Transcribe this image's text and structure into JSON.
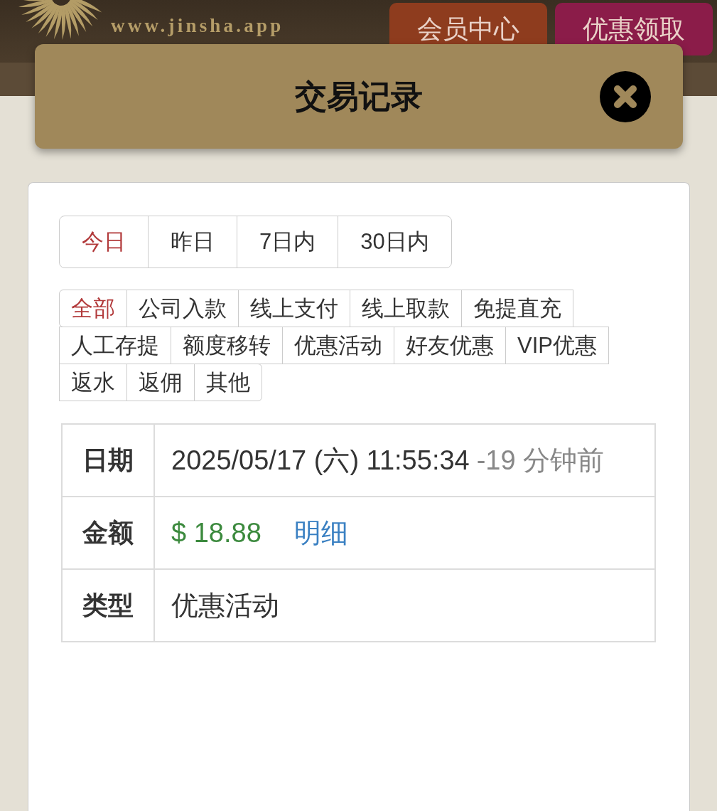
{
  "header": {
    "site": "www.jinsha.app",
    "buttons": [
      {
        "label": "会员中心",
        "color": "#8e3c1e"
      },
      {
        "label": "优惠领取",
        "color": "#8b1c49"
      }
    ]
  },
  "dialog": {
    "title": "交易记录"
  },
  "date_range": [
    {
      "label": "今日",
      "selected": true
    },
    {
      "label": "昨日",
      "selected": false
    },
    {
      "label": "7日内",
      "selected": false
    },
    {
      "label": "30日内",
      "selected": false
    }
  ],
  "categories": [
    {
      "label": "全部",
      "selected": true
    },
    {
      "label": "公司入款",
      "selected": false
    },
    {
      "label": "线上支付",
      "selected": false
    },
    {
      "label": "线上取款",
      "selected": false
    },
    {
      "label": "免提直充",
      "selected": false
    },
    {
      "label": "人工存提",
      "selected": false
    },
    {
      "label": "额度移转",
      "selected": false
    },
    {
      "label": "优惠活动",
      "selected": false
    },
    {
      "label": "好友优惠",
      "selected": false
    },
    {
      "label": "VIP优惠",
      "selected": false
    },
    {
      "label": "返水",
      "selected": false
    },
    {
      "label": "返佣",
      "selected": false
    },
    {
      "label": "其他",
      "selected": false
    }
  ],
  "record": {
    "rows": [
      {
        "kind": "date",
        "label": "日期",
        "value": "2025/05/17 (六) 11:55:34",
        "relative": "-19 分钟前"
      },
      {
        "kind": "amount",
        "label": "金额",
        "value": "$ 18.88",
        "link": "明细"
      },
      {
        "kind": "text",
        "label": "类型",
        "value": "优惠活动"
      }
    ]
  }
}
